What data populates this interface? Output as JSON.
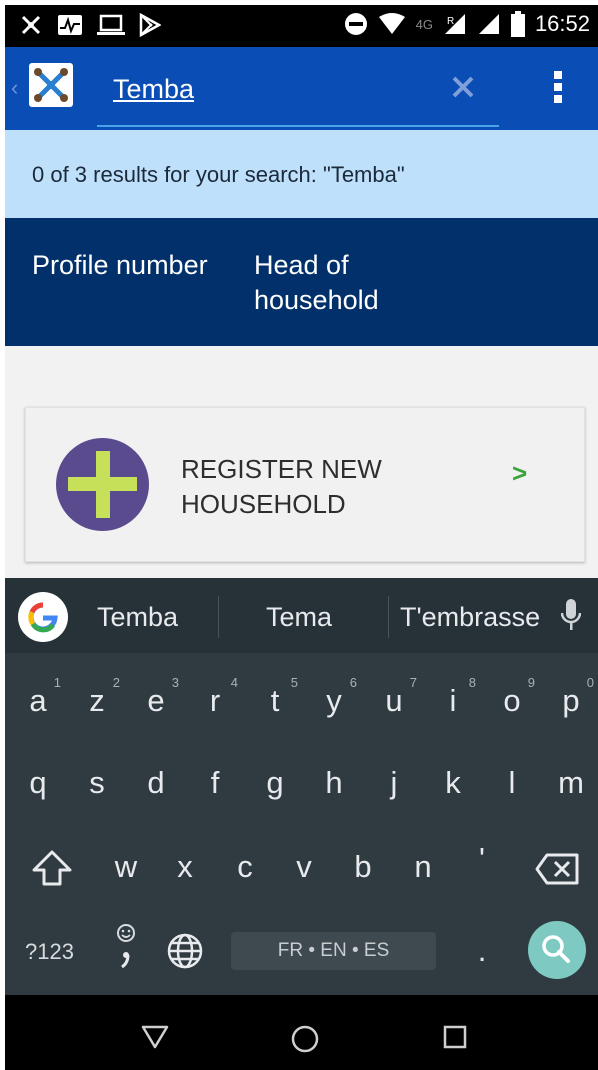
{
  "status_bar": {
    "network": "4G",
    "roaming": "R",
    "time": "16:52"
  },
  "app_bar": {
    "search_value": "Temba"
  },
  "results": {
    "text": "0 of 3 results for your search: \"Temba\""
  },
  "table_header": {
    "col1": "Profile number",
    "col2": "Head of household"
  },
  "register_card": {
    "label": "REGISTER NEW HOUSEHOLD",
    "chevron": ">"
  },
  "suggestions": [
    "Temba",
    "Tema",
    "T'embrasse"
  ],
  "keyboard": {
    "row1": [
      {
        "k": "a",
        "n": "1"
      },
      {
        "k": "z",
        "n": "2"
      },
      {
        "k": "e",
        "n": "3"
      },
      {
        "k": "r",
        "n": "4"
      },
      {
        "k": "t",
        "n": "5"
      },
      {
        "k": "y",
        "n": "6"
      },
      {
        "k": "u",
        "n": "7"
      },
      {
        "k": "i",
        "n": "8"
      },
      {
        "k": "o",
        "n": "9"
      },
      {
        "k": "p",
        "n": "0"
      }
    ],
    "row2": [
      "q",
      "s",
      "d",
      "f",
      "g",
      "h",
      "j",
      "k",
      "l",
      "m"
    ],
    "row3": [
      "w",
      "x",
      "c",
      "v",
      "b",
      "n",
      "'"
    ],
    "symbols": "?123",
    "space_label": "FR • EN • ES",
    "period": "."
  },
  "colors": {
    "app_bar": "#0a4db4",
    "results_banner": "#bfe0fb",
    "table_header": "#01306b",
    "register_circle": "#5a4b8e",
    "register_plus": "#c6e05a",
    "chevron": "#3aa33a",
    "keyboard": "#2f3b40",
    "search_key": "#7ecac3"
  }
}
